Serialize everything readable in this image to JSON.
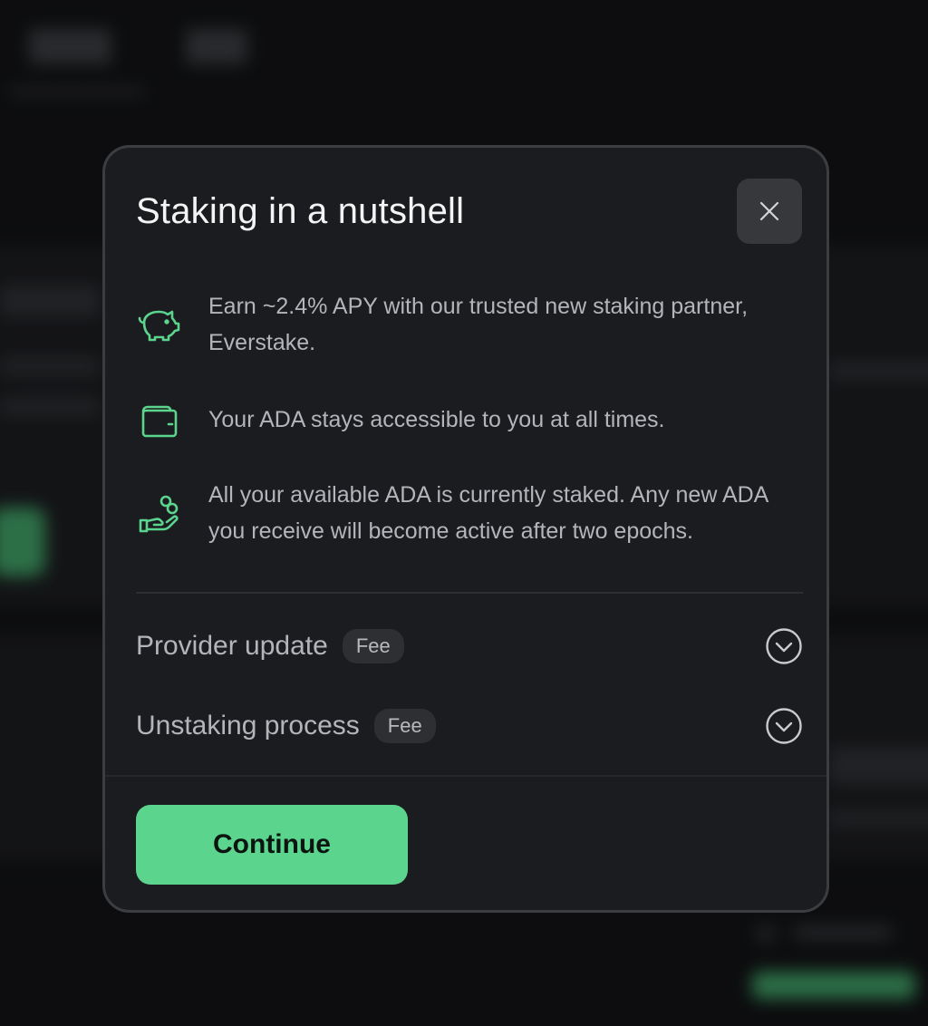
{
  "colors": {
    "accent": "#5bd48e",
    "icon_green": "#5bd48e",
    "modal_bg": "#1b1c1f",
    "page_bg": "#121315"
  },
  "modal": {
    "title": "Staking in a nutshell",
    "close_icon": "close-icon",
    "features": [
      {
        "icon": "piggy-bank-icon",
        "text": "Earn ~2.4% APY with our trusted new staking partner, Everstake."
      },
      {
        "icon": "wallet-icon",
        "text": "Your ADA stays accessible to you at all times."
      },
      {
        "icon": "hand-coins-icon",
        "text": "All your available ADA is currently staked. Any new ADA you receive will become active after two epochs."
      }
    ],
    "accordions": [
      {
        "label": "Provider update",
        "badge": "Fee",
        "icon": "chevron-down-circle-icon"
      },
      {
        "label": "Unstaking process",
        "badge": "Fee",
        "icon": "chevron-down-circle-icon"
      }
    ],
    "continue_label": "Continue"
  }
}
